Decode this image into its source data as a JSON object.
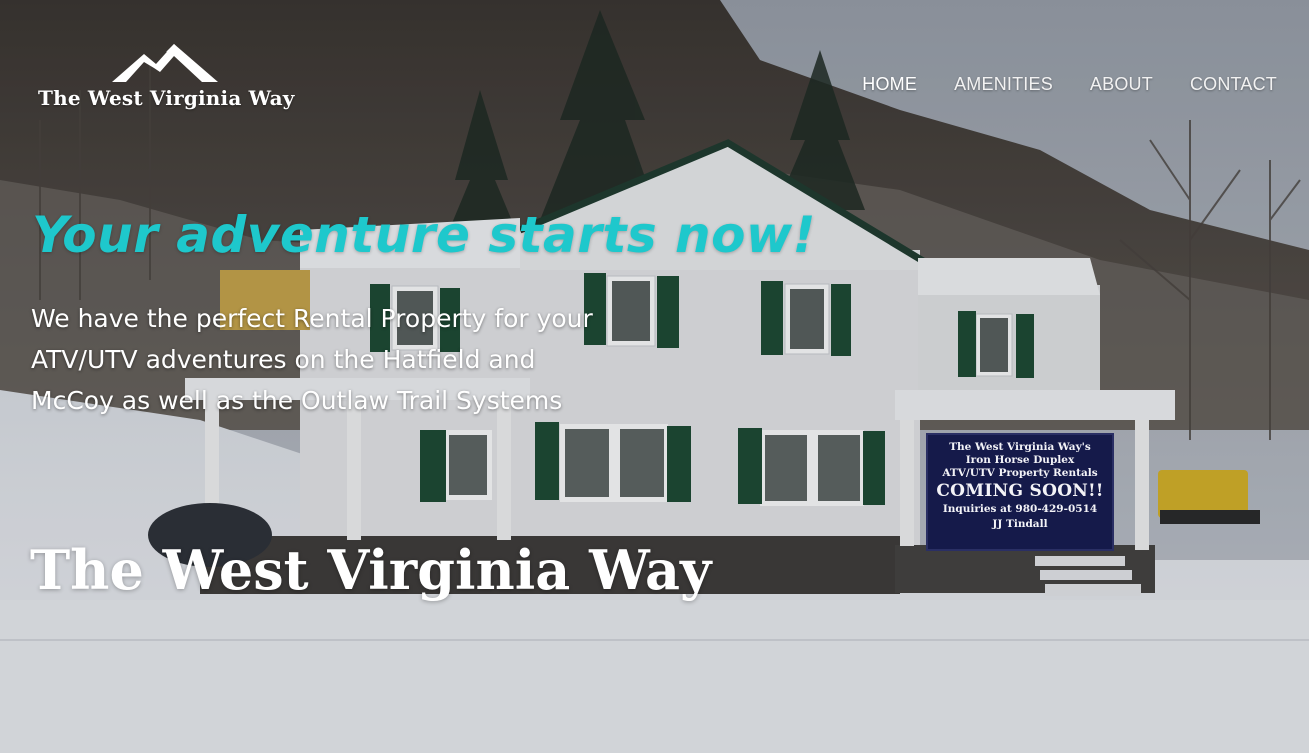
{
  "brand": {
    "logo_text": "The West Virginia Way",
    "logo_icon": "mountains-icon"
  },
  "nav": {
    "items": [
      {
        "label": "HOME",
        "active": true
      },
      {
        "label": "AMENITIES",
        "active": false
      },
      {
        "label": "ABOUT",
        "active": false
      },
      {
        "label": "CONTACT",
        "active": false
      }
    ]
  },
  "hero": {
    "headline": "Your adventure starts now!",
    "subtext_lines": [
      "We have the perfect Rental Property for your",
      "ATV/UTV adventures on the Hatfield and",
      "McCoy as well as the Outlaw Trail Systems"
    ],
    "title": "The West Virginia Way"
  },
  "banner": {
    "line1": "The West Virginia Way's",
    "line2": "Iron Horse Duplex",
    "line3": "ATV/UTV Property Rentals",
    "line4": "COMING SOON!!",
    "line5": "Inquiries at  980-429-0514",
    "line6": "JJ Tindall"
  },
  "colors": {
    "accent": "#1ec8cc",
    "nav_text": "#f2f2f2",
    "banner_bg": "#151a4a"
  }
}
